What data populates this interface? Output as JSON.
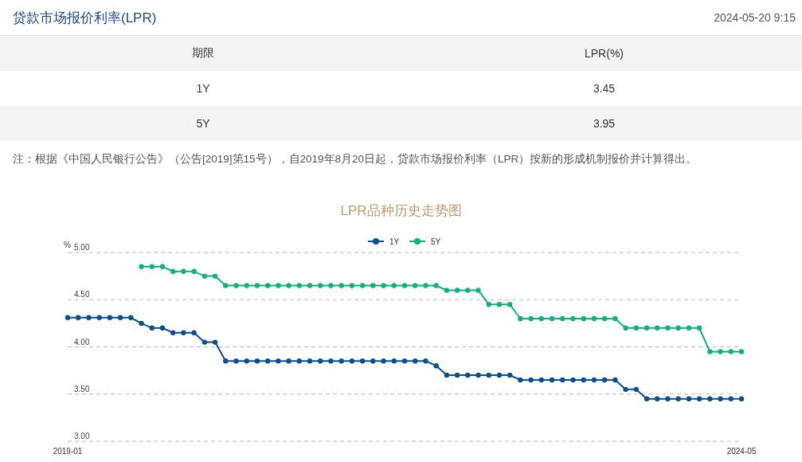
{
  "header": {
    "title": "贷款市场报价利率(LPR)",
    "datetime": "2024-05-20 9:15"
  },
  "table": {
    "columns": [
      "期限",
      "LPR(%)"
    ],
    "rows": [
      [
        "1Y",
        "3.45"
      ],
      [
        "5Y",
        "3.95"
      ]
    ]
  },
  "note": "注：根据《中国人民银行公告》（公告[2019]第15号），自2019年8月20日起，贷款市场报价利率（LPR）按新的形成机制报价并计算得出。",
  "chart": {
    "chart_data": {
      "type": "line",
      "grid": true,
      "legend": true,
      "title": "LPR品种历史走势图",
      "ylabel": "%",
      "ylim": [
        3,
        5
      ],
      "yticks": [
        {
          "value": 3,
          "label": "3.00"
        },
        {
          "value": 3.5,
          "label": "3.50"
        },
        {
          "value": 4,
          "label": "4.00"
        },
        {
          "value": 4.5,
          "label": "4.50"
        },
        {
          "value": 5,
          "label": "5.00"
        }
      ],
      "categories": [
        "2019-01",
        null,
        null,
        null,
        null,
        null,
        null,
        null,
        null,
        null,
        null,
        null,
        null,
        null,
        null,
        null,
        null,
        null,
        null,
        null,
        null,
        null,
        null,
        null,
        null,
        null,
        null,
        null,
        null,
        null,
        null,
        null,
        null,
        null,
        null,
        null,
        null,
        null,
        null,
        null,
        null,
        null,
        null,
        null,
        null,
        null,
        null,
        null,
        null,
        null,
        null,
        null,
        null,
        null,
        null,
        null,
        null,
        null,
        null,
        null,
        null,
        null,
        null,
        null,
        "2024-05"
      ],
      "series": [
        {
          "name": "1Y",
          "color": "#0b4f91",
          "marker": "circle",
          "values": [
            4.31,
            4.31,
            4.31,
            4.31,
            4.31,
            4.31,
            4.31,
            4.25,
            4.2,
            4.2,
            4.15,
            4.15,
            4.15,
            4.05,
            4.05,
            3.85,
            3.85,
            3.85,
            3.85,
            3.85,
            3.85,
            3.85,
            3.85,
            3.85,
            3.85,
            3.85,
            3.85,
            3.85,
            3.85,
            3.85,
            3.85,
            3.85,
            3.85,
            3.85,
            3.85,
            3.8,
            3.7,
            3.7,
            3.7,
            3.7,
            3.7,
            3.7,
            3.7,
            3.65,
            3.65,
            3.65,
            3.65,
            3.65,
            3.65,
            3.65,
            3.65,
            3.65,
            3.65,
            3.55,
            3.55,
            3.45,
            3.45,
            3.45,
            3.45,
            3.45,
            3.45,
            3.45,
            3.45,
            3.45,
            3.45
          ]
        },
        {
          "name": "5Y",
          "color": "#0fb27a",
          "marker": "circle",
          "values": [
            null,
            null,
            null,
            null,
            null,
            null,
            null,
            4.85,
            4.85,
            4.85,
            4.8,
            4.8,
            4.8,
            4.75,
            4.75,
            4.65,
            4.65,
            4.65,
            4.65,
            4.65,
            4.65,
            4.65,
            4.65,
            4.65,
            4.65,
            4.65,
            4.65,
            4.65,
            4.65,
            4.65,
            4.65,
            4.65,
            4.65,
            4.65,
            4.65,
            4.65,
            4.6,
            4.6,
            4.6,
            4.6,
            4.45,
            4.45,
            4.45,
            4.3,
            4.3,
            4.3,
            4.3,
            4.3,
            4.3,
            4.3,
            4.3,
            4.3,
            4.3,
            4.2,
            4.2,
            4.2,
            4.2,
            4.2,
            4.2,
            4.2,
            4.2,
            3.95,
            3.95,
            3.95,
            3.95
          ]
        }
      ]
    }
  }
}
